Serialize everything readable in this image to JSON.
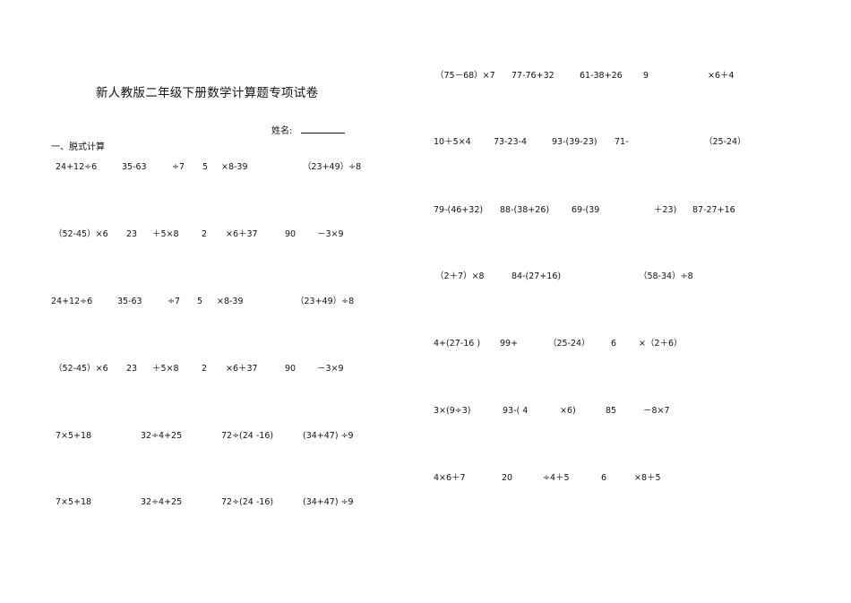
{
  "title": "新人教版二年级下册数学计算题专项试卷",
  "name_label": "姓名:",
  "section_heading": "一、脱式计算",
  "left_rows": [
    [
      "24+12÷6",
      "35-63",
      "÷7",
      "5",
      "×8-39",
      "（23+49）÷8"
    ],
    [
      "（52-45）×6",
      "23",
      "＋5×8",
      "2",
      "×6＋37",
      "90",
      "－3×9"
    ],
    [
      "24+12÷6",
      "35-63",
      "÷7",
      "5",
      "×8-39",
      "（23+49）÷8"
    ],
    [
      "（52-45）×6",
      "23",
      "＋5×8",
      "2",
      "×6＋37",
      "90",
      "－3×9"
    ],
    [
      "7×5+18",
      "32÷4+25",
      "72÷(24 -16)",
      "(34+47) ÷9"
    ],
    [
      "7×5+18",
      "32÷4+25",
      "72÷(24 -16)",
      "(34+47) ÷9"
    ]
  ],
  "right_rows": [
    [
      "（75－68）×7",
      "77-76+32",
      "61-38+26",
      "9",
      "×6＋4"
    ],
    [
      "10＋5×4",
      "73-23-4",
      "93-(39-23)",
      "71-",
      "（25-24）"
    ],
    [
      "79-(46+32)",
      "88-(38+26)",
      "69-(39",
      "＋23)",
      "87-27+16"
    ],
    [
      "（2＋7）×8",
      "84-(27+16)",
      "（58-34）÷8"
    ],
    [
      "4+(27-16 )",
      "99+",
      "（25-24）",
      "6",
      "×（2＋6）"
    ],
    [
      "3×(9÷3)",
      "93-( 4",
      "×6)",
      "85",
      "－8×7"
    ],
    [
      "4×6＋7",
      "20",
      "÷4＋5",
      "6",
      "×8＋5"
    ]
  ]
}
